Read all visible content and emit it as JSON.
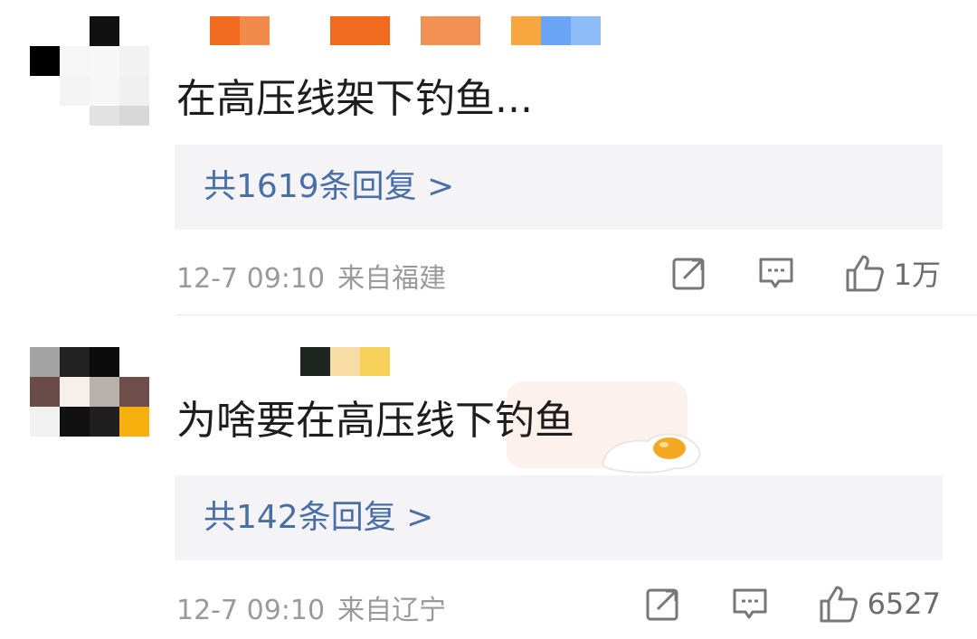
{
  "comments": [
    {
      "text": "在高压线架下钓鱼...",
      "reply_label": "共1619条回复 >",
      "date": "12-7 09:10",
      "location": "来自福建",
      "like_count": "1万",
      "name_colors": [
        "#f06a1f",
        "#f28a4c",
        "#f06a1f",
        "#f29055",
        "#f8a640",
        "#6aa4f4",
        "#8dbcf6"
      ],
      "avatar_colors": [
        "#ffffff",
        "#111111",
        "#ffffff",
        "#000000",
        "#f4f4f4",
        "#f7f7f7",
        "#ffffff",
        "#f0f0f0",
        "#e0e0e0"
      ]
    },
    {
      "text": "为啥要在高压线下钓鱼",
      "reply_label": "共142条回复 >",
      "date": "12-7 09:10",
      "location": "来自辽宁",
      "like_count": "6527",
      "name_colors": [
        "#1e2420",
        "#f7dca6",
        "#f7d05a"
      ],
      "avatar_colors": [
        "#a3a3a3",
        "#222222",
        "#0b0b0b",
        "#6b4b47",
        "#f7f0ea",
        "#b8b1ab",
        "#f1f1f1",
        "#111111",
        "#f5b00d",
        "#1f1f1f",
        "#6f4d48"
      ]
    }
  ],
  "icons": {
    "share": "share-icon",
    "comment": "comment-icon",
    "like": "thumbs-up-icon"
  }
}
